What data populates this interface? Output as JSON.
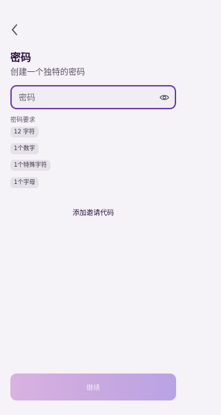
{
  "header": {
    "back_icon": "chevron-left-icon"
  },
  "title": "密码",
  "subtitle": "创建一个独特的密码",
  "password_field": {
    "value": "",
    "placeholder": "密码",
    "toggle_icon": "eye-icon"
  },
  "requirements": {
    "label": "密码要求",
    "items": [
      "12 字符",
      "1个数字",
      "1个特殊字符",
      "1个字母"
    ]
  },
  "invite_link": "添加邀请代码",
  "continue_button": "继续",
  "colors": {
    "accent": "#6f3bb0",
    "background": "#f5f2f8",
    "button_start": "#d9b2e0",
    "button_end": "#b9a3e5"
  }
}
